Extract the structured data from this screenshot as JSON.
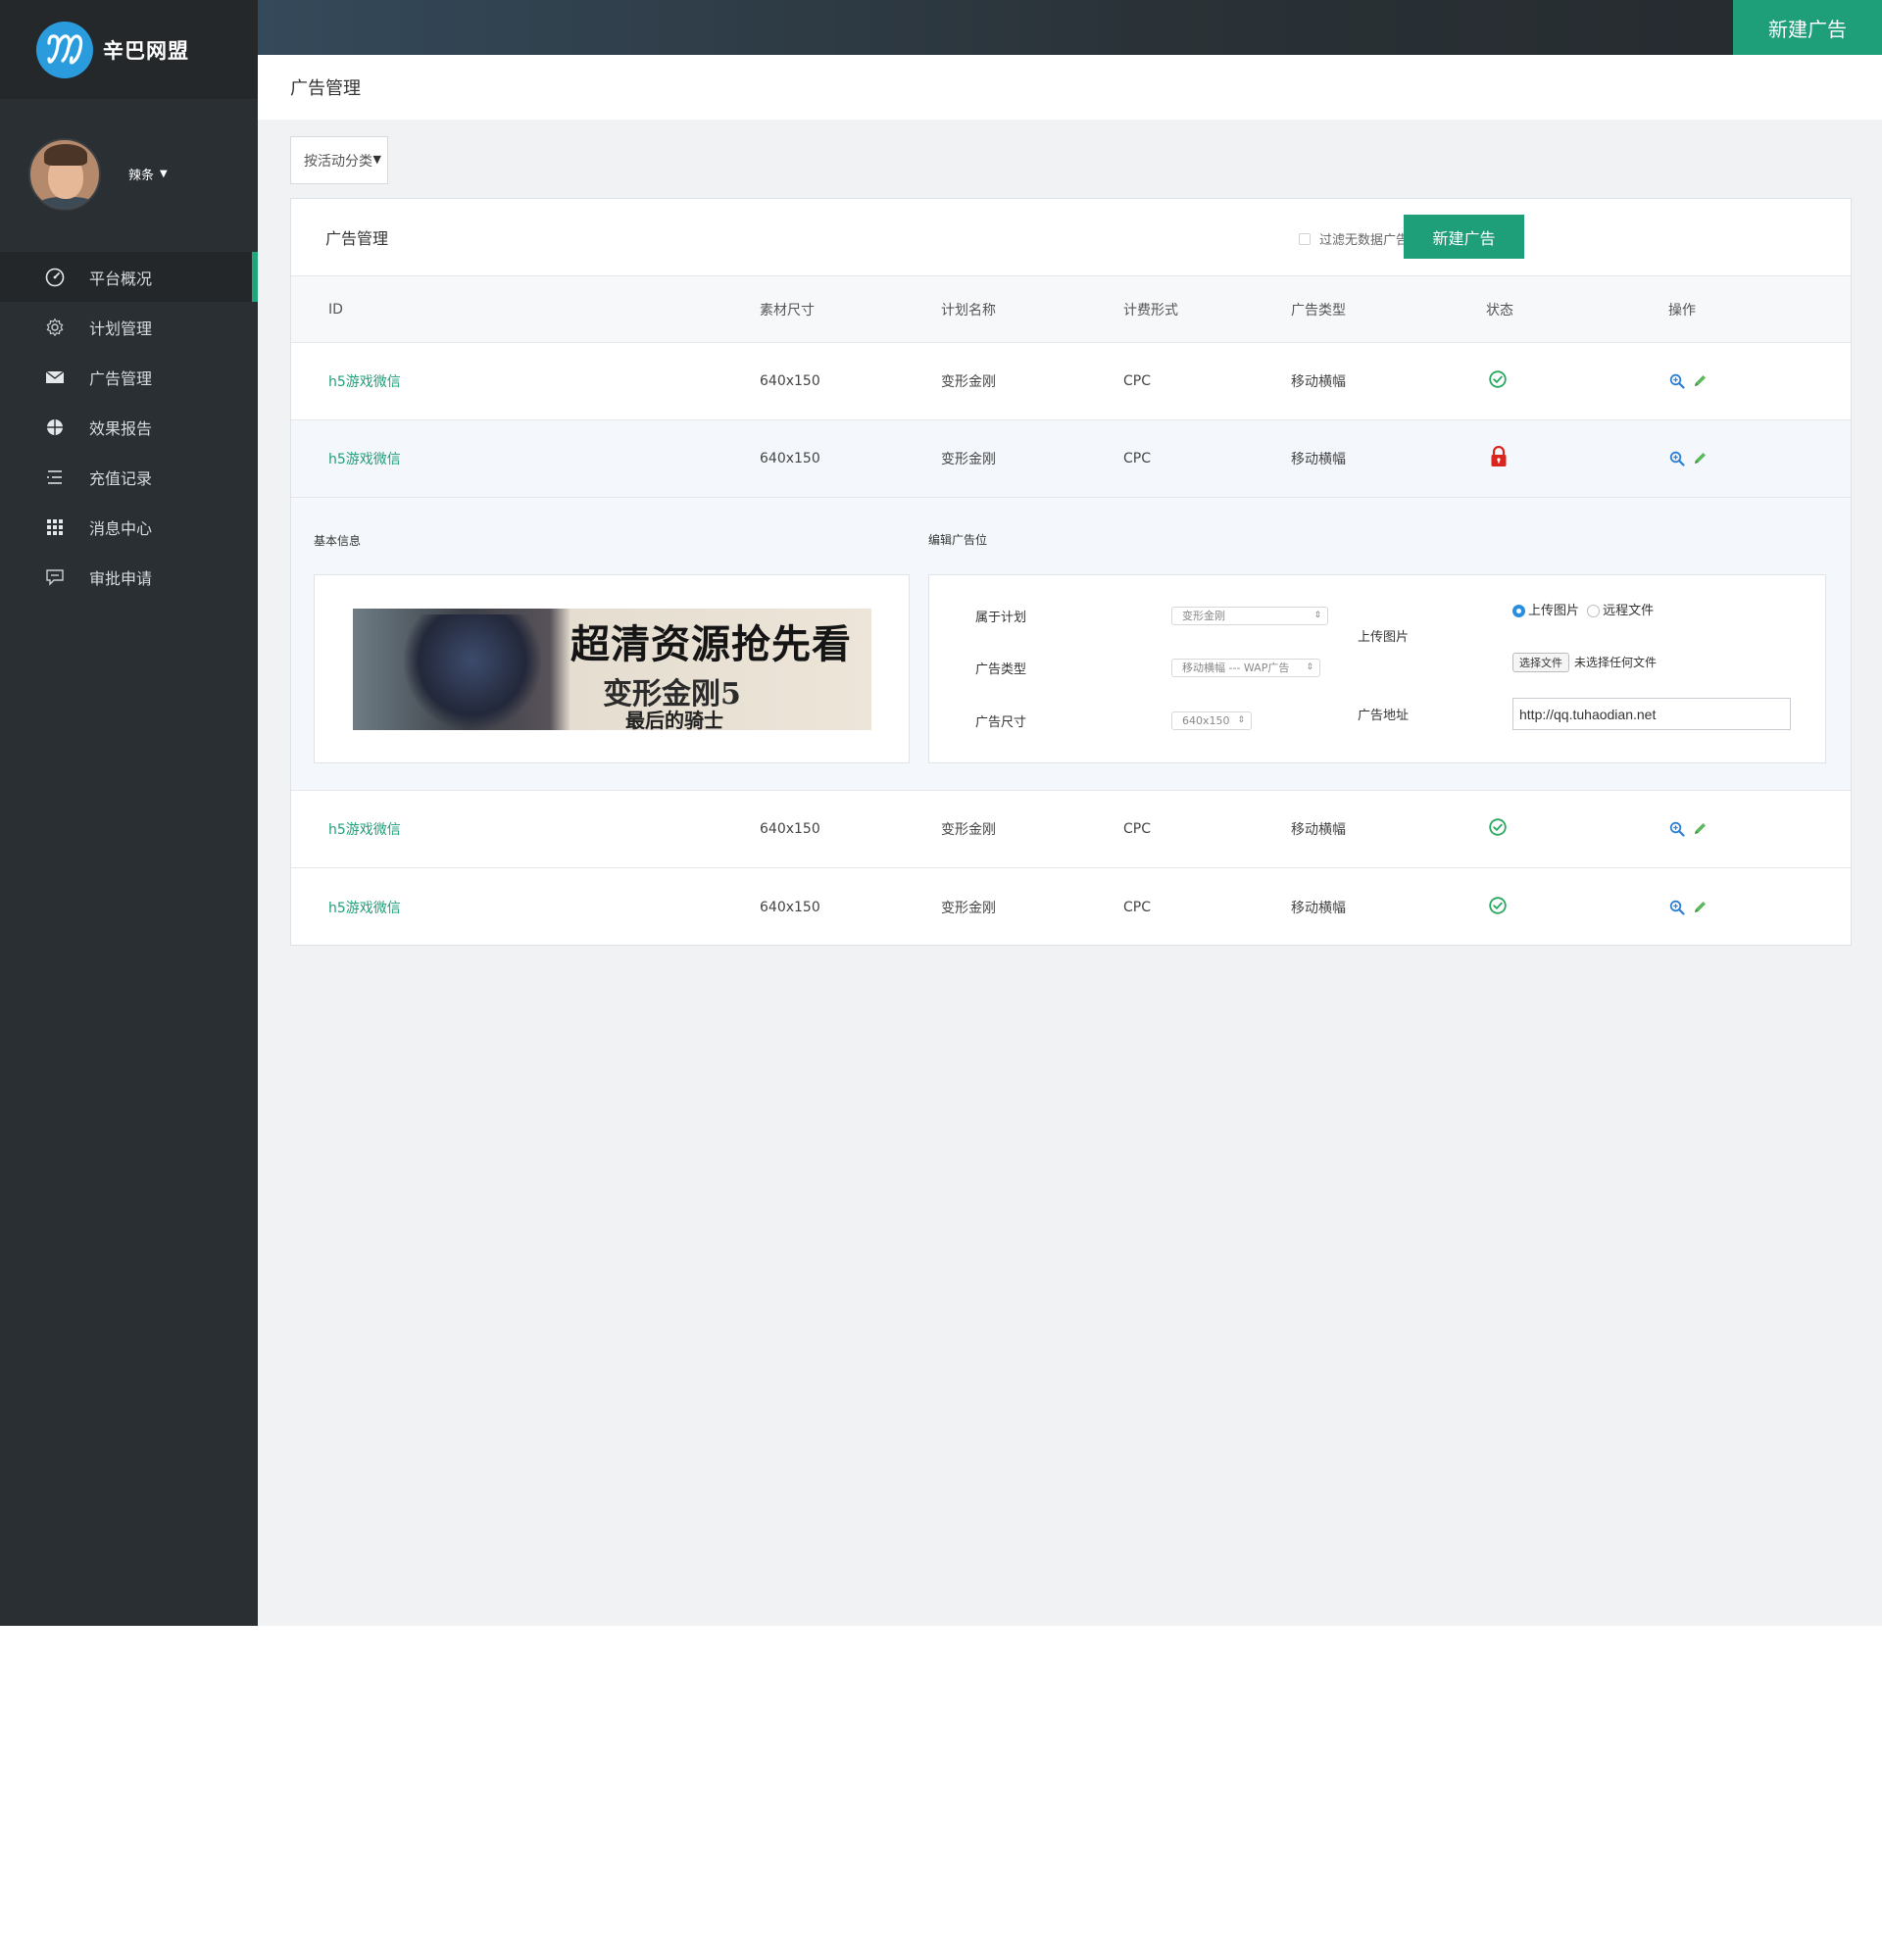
{
  "brand": {
    "name": "辛巴网盟"
  },
  "user": {
    "name": "辣条",
    "caret": "▼"
  },
  "nav": [
    {
      "label": "平台概况",
      "icon": "dashboard-icon",
      "active": true
    },
    {
      "label": "计划管理",
      "icon": "gear-icon"
    },
    {
      "label": "广告管理",
      "icon": "envelope-icon"
    },
    {
      "label": "效果报告",
      "icon": "globe-icon"
    },
    {
      "label": "充值记录",
      "icon": "list-icon"
    },
    {
      "label": "消息中心",
      "icon": "grid-icon"
    },
    {
      "label": "审批申请",
      "icon": "chat-icon"
    }
  ],
  "topbar": {
    "new_ad": "新建广告"
  },
  "page": {
    "title": "广告管理"
  },
  "filter": {
    "label": "按活动分类",
    "arrow": "▼"
  },
  "panel": {
    "title": "广告管理",
    "filter_checkbox": "过滤无数据广告",
    "new_ad": "新建广告"
  },
  "table": {
    "headers": [
      "ID",
      "素材尺寸",
      "计划名称",
      "计费形式",
      "广告类型",
      "状态",
      "操作"
    ],
    "rows": [
      {
        "id": "h5游戏微信",
        "size": "640x150",
        "plan": "变形金刚",
        "billing": "CPC",
        "type": "移动横幅",
        "status": "ok"
      },
      {
        "id": "h5游戏微信",
        "size": "640x150",
        "plan": "变形金刚",
        "billing": "CPC",
        "type": "移动横幅",
        "status": "locked"
      },
      {
        "id": "h5游戏微信",
        "size": "640x150",
        "plan": "变形金刚",
        "billing": "CPC",
        "type": "移动横幅",
        "status": "ok"
      },
      {
        "id": "h5游戏微信",
        "size": "640x150",
        "plan": "变形金刚",
        "billing": "CPC",
        "type": "移动横幅",
        "status": "ok"
      }
    ]
  },
  "detail": {
    "basic_info": "基本信息",
    "edit_title": "编辑广告位",
    "banner": {
      "line1": "超清资源抢先看",
      "line2": "变形金刚5",
      "line3": "最后的骑士"
    },
    "plan_label": "属于计划",
    "plan_value": "变形金刚",
    "type_label": "广告类型",
    "type_value": "移动横幅 --- WAP广告",
    "size_label": "广告尺寸",
    "size_value": "640x150",
    "upload_label": "上传图片",
    "radio_upload": "上传图片",
    "radio_remote": "远程文件",
    "choose_file": "选择文件",
    "no_file": "未选择任何文件",
    "url_label": "广告地址",
    "url_value": "http://qq.tuhaodian.net"
  },
  "colors": {
    "accent": "#1f9e7a",
    "sidebar": "#2a2f33",
    "ok": "#29a85f",
    "lock": "#d9251c",
    "op_view": "#2a7fd4",
    "op_edit": "#5cb85c"
  }
}
